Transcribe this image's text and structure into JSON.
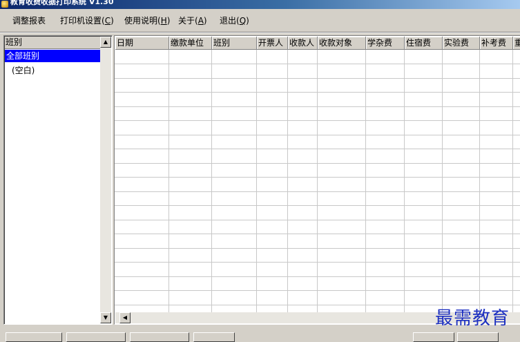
{
  "window": {
    "title": "教育收费收据打印系统 V1.30"
  },
  "menu": [
    {
      "label": "调整报表",
      "mnemonic": ""
    },
    {
      "label": "打印机设置(",
      "mnemonic": "C",
      "tail": ")"
    },
    {
      "label": "使用说明(",
      "mnemonic": "H",
      "tail": ")"
    },
    {
      "label": "关于(",
      "mnemonic": "A",
      "tail": ")"
    },
    {
      "label": "退出(",
      "mnemonic": "Q",
      "tail": ")"
    }
  ],
  "tree": {
    "header": "班别",
    "items": [
      {
        "label": "全部班别",
        "selected": true
      },
      {
        "label": "(空白)",
        "selected": false
      }
    ]
  },
  "grid": {
    "columns": [
      "日期",
      "缴款单位",
      "班别",
      "开票人",
      "收款人",
      "收款对象",
      "学杂费",
      "住宿费",
      "实验费",
      "补考费",
      "重"
    ]
  },
  "watermark": "最需教育",
  "icons": {
    "scroll_up": "scroll-up-arrow-icon",
    "scroll_down": "scroll-down-arrow-icon",
    "scroll_left": "scroll-left-arrow-icon",
    "app": "app-icon"
  }
}
